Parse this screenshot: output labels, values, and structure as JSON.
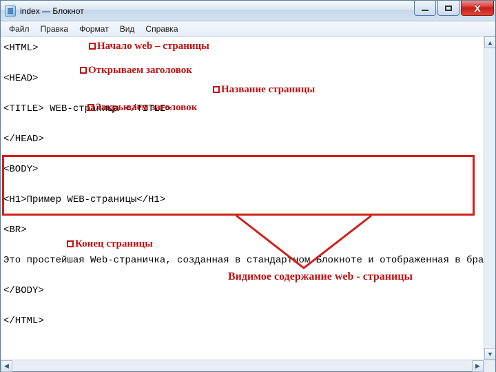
{
  "window": {
    "title": "index — Блокнот"
  },
  "menu": {
    "file": "Файл",
    "edit": "Правка",
    "format": "Формат",
    "view": "Вид",
    "help": "Справка"
  },
  "code": {
    "l1": "<HTML>",
    "l2": "",
    "l3": "<HEAD>",
    "l4": "",
    "l5": "<TITLE> WEB-страница </TITLE>",
    "l6": "",
    "l7": "</HEAD>",
    "l8": "",
    "l9": "<BODY>",
    "l10": "",
    "l11": "<H1>Пример WEB-страницы</H1>",
    "l12": "",
    "l13": "<BR>",
    "l14": "",
    "l15": "Это простейшая Web-страничка, созданная в стандартном Блокноте и отображенная в браузере.",
    "l16": "",
    "l17": "</BODY>",
    "l18": "",
    "l19": "</HTML>"
  },
  "annotations": {
    "start": "Начало web – страницы",
    "open_head": "Открываем заголовок",
    "title": "Название страницы",
    "close_head": "Закрываем заголовок",
    "end": "Конец страницы",
    "visible": "Видимое содержание web - страницы"
  }
}
